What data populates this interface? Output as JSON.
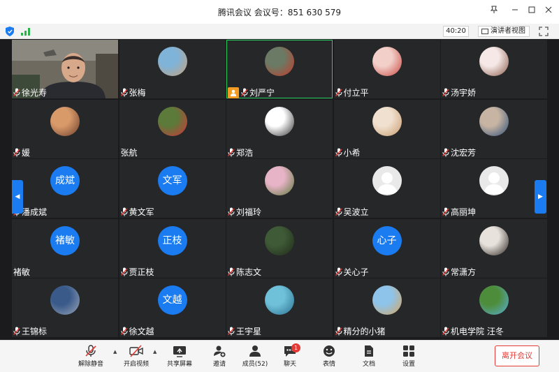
{
  "window": {
    "title": "腾讯会议 会议号：851 630 579"
  },
  "infobar": {
    "timer": "40:20",
    "speaker_view_label": "演讲者视图"
  },
  "participants": [
    {
      "name": "徐光寿",
      "avatar_type": "camera",
      "muted": true
    },
    {
      "name": "张梅",
      "avatar_type": "photo",
      "muted": true,
      "colors": [
        "#7fb3d8",
        "#c9a27a"
      ]
    },
    {
      "name": "刘严宁",
      "avatar_type": "photo",
      "muted": true,
      "host": true,
      "active": true,
      "colors": [
        "#6b7a64",
        "#c43a2a"
      ]
    },
    {
      "name": "付立平",
      "avatar_type": "photo",
      "muted": true,
      "colors": [
        "#f2cfc9",
        "#c9463f"
      ]
    },
    {
      "name": "汤宇娇",
      "avatar_type": "photo",
      "muted": true,
      "colors": [
        "#f5e8e6",
        "#8a5a4a"
      ]
    },
    {
      "name": "媛",
      "avatar_type": "photo",
      "muted": true,
      "colors": [
        "#d99a6a",
        "#6a3e2c"
      ]
    },
    {
      "name": "张航",
      "avatar_type": "photo",
      "muted": false,
      "colors": [
        "#5c7a3a",
        "#d5353a"
      ]
    },
    {
      "name": "郑浩",
      "avatar_type": "photo",
      "muted": true,
      "colors": [
        "#ffffff",
        "#333333"
      ]
    },
    {
      "name": "小希",
      "avatar_type": "photo",
      "muted": true,
      "colors": [
        "#f0e0cf",
        "#c89a6c"
      ]
    },
    {
      "name": "沈宏芳",
      "avatar_type": "photo",
      "muted": true,
      "colors": [
        "#c7b4a2",
        "#2e4f7a"
      ]
    },
    {
      "name": "潘成斌",
      "avatar_type": "text",
      "avatar_text": "成斌",
      "muted": true
    },
    {
      "name": "黄文军",
      "avatar_type": "text",
      "avatar_text": "文军",
      "muted": true
    },
    {
      "name": "刘福玲",
      "avatar_type": "photo",
      "muted": true,
      "colors": [
        "#e7b3c7",
        "#5b7a3a"
      ]
    },
    {
      "name": "吴波立",
      "avatar_type": "default",
      "muted": true
    },
    {
      "name": "高丽坤",
      "avatar_type": "default",
      "muted": true
    },
    {
      "name": "褚敏",
      "avatar_type": "text",
      "avatar_text": "褚敏",
      "muted": false
    },
    {
      "name": "贾正枝",
      "avatar_type": "text",
      "avatar_text": "正枝",
      "muted": true
    },
    {
      "name": "陈志文",
      "avatar_type": "photo",
      "muted": true,
      "colors": [
        "#3f5a36",
        "#1f2a1a"
      ]
    },
    {
      "name": "关心子",
      "avatar_type": "text",
      "avatar_text": "心子",
      "muted": true
    },
    {
      "name": "常潇方",
      "avatar_type": "photo",
      "muted": true,
      "colors": [
        "#e8e2dc",
        "#2a2320"
      ]
    },
    {
      "name": "王锦标",
      "avatar_type": "photo",
      "muted": true,
      "colors": [
        "#3a5a8a",
        "#9aa6b8"
      ]
    },
    {
      "name": "徐文越",
      "avatar_type": "text",
      "avatar_text": "文越",
      "muted": true
    },
    {
      "name": "王宇星",
      "avatar_type": "photo",
      "muted": true,
      "colors": [
        "#6fc1d9",
        "#2b6f8f"
      ]
    },
    {
      "name": "精分的小猪",
      "avatar_type": "photo",
      "muted": true,
      "colors": [
        "#8ec4ea",
        "#d9a45c"
      ]
    },
    {
      "name": "机电学院 汪冬",
      "avatar_type": "photo",
      "muted": true,
      "colors": [
        "#4d8c3a",
        "#5ab0d9"
      ]
    }
  ],
  "toolbar": {
    "unmute": "解除静音",
    "start_video": "开启视频",
    "share_screen": "共享屏幕",
    "invite": "邀请",
    "members": "成员(52)",
    "chat": "聊天",
    "chat_badge": "1",
    "reactions": "表情",
    "docs": "文档",
    "settings": "设置",
    "leave": "离开会议"
  },
  "colors": {
    "accent": "#1a7cf0",
    "active_border": "#2bd064",
    "host_badge": "#f39c23",
    "danger": "#e53935"
  }
}
